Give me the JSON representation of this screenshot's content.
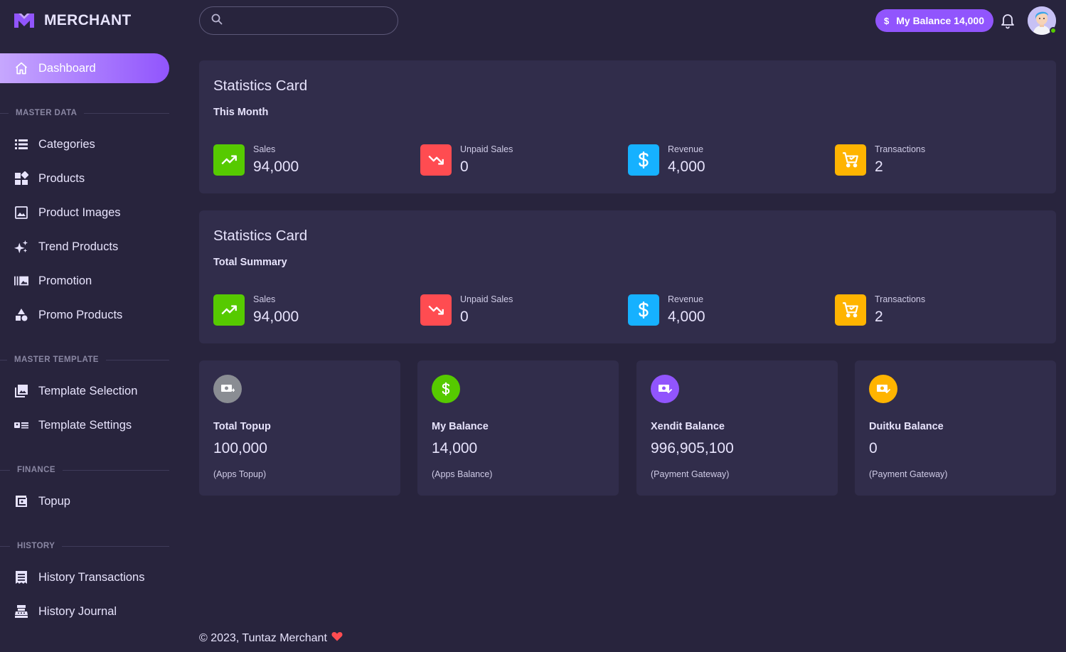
{
  "brand": {
    "name": "MERCHANT",
    "logo_icon": "m-logo-icon"
  },
  "header": {
    "search_placeholder": "",
    "balance_label": "My Balance 14,000",
    "balance_currency": "$",
    "notification_icon": "bell-icon"
  },
  "sidebar": {
    "dashboard": {
      "label": "Dashboard",
      "icon": "home-icon"
    },
    "sections": {
      "master_data": "MASTER DATA",
      "master_template": "MASTER TEMPLATE",
      "finance": "FINANCE",
      "history": "HISTORY"
    },
    "items": [
      {
        "label": "Categories",
        "icon": "list-icon"
      },
      {
        "label": "Products",
        "icon": "widgets-icon"
      },
      {
        "label": "Product Images",
        "icon": "image-icon"
      },
      {
        "label": "Trend Products",
        "icon": "sparkle-icon"
      },
      {
        "label": "Promotion",
        "icon": "gallery-icon"
      },
      {
        "label": "Promo Products",
        "icon": "shapes-icon"
      },
      {
        "label": "Template Selection",
        "icon": "image-multiple-icon"
      },
      {
        "label": "Template Settings",
        "icon": "card-text-icon"
      },
      {
        "label": "Topup",
        "icon": "wallet-icon"
      },
      {
        "label": "History Transactions",
        "icon": "receipt-icon"
      },
      {
        "label": "History Journal",
        "icon": "cash-register-icon"
      }
    ]
  },
  "stats_month": {
    "title": "Statistics Card",
    "subtitle": "This Month",
    "items": [
      {
        "label": "Sales",
        "value": "94,000",
        "color": "#56ca00",
        "icon": "trending-up-icon"
      },
      {
        "label": "Unpaid Sales",
        "value": "0",
        "color": "#ff4c51",
        "icon": "trending-down-icon"
      },
      {
        "label": "Revenue",
        "value": "4,000",
        "color": "#16b1ff",
        "icon": "dollar-icon"
      },
      {
        "label": "Transactions",
        "value": "2",
        "color": "#ffb400",
        "icon": "cart-icon"
      }
    ]
  },
  "stats_total": {
    "title": "Statistics Card",
    "subtitle": "Total Summary",
    "items": [
      {
        "label": "Sales",
        "value": "94,000",
        "color": "#56ca00",
        "icon": "trending-up-icon"
      },
      {
        "label": "Unpaid Sales",
        "value": "0",
        "color": "#ff4c51",
        "icon": "trending-down-icon"
      },
      {
        "label": "Revenue",
        "value": "4,000",
        "color": "#16b1ff",
        "icon": "dollar-icon"
      },
      {
        "label": "Transactions",
        "value": "2",
        "color": "#ffb400",
        "icon": "cart-icon"
      }
    ]
  },
  "balances": [
    {
      "title": "Total Topup",
      "value": "100,000",
      "note": "(Apps Topup)",
      "color": "#8a8d93",
      "icon": "cash-plus-icon"
    },
    {
      "title": "My Balance",
      "value": "14,000",
      "note": "(Apps Balance)",
      "color": "#56ca00",
      "icon": "dollar-icon"
    },
    {
      "title": "Xendit Balance",
      "value": "996,905,100",
      "note": "(Payment Gateway)",
      "color": "#9155fd",
      "icon": "cash-check-icon"
    },
    {
      "title": "Duitku Balance",
      "value": "0",
      "note": "(Payment Gateway)",
      "color": "#ffb400",
      "icon": "cash-check-icon"
    }
  ],
  "footer": {
    "text": "© 2023, Tuntaz Merchant",
    "heart_icon": "heart-icon"
  }
}
